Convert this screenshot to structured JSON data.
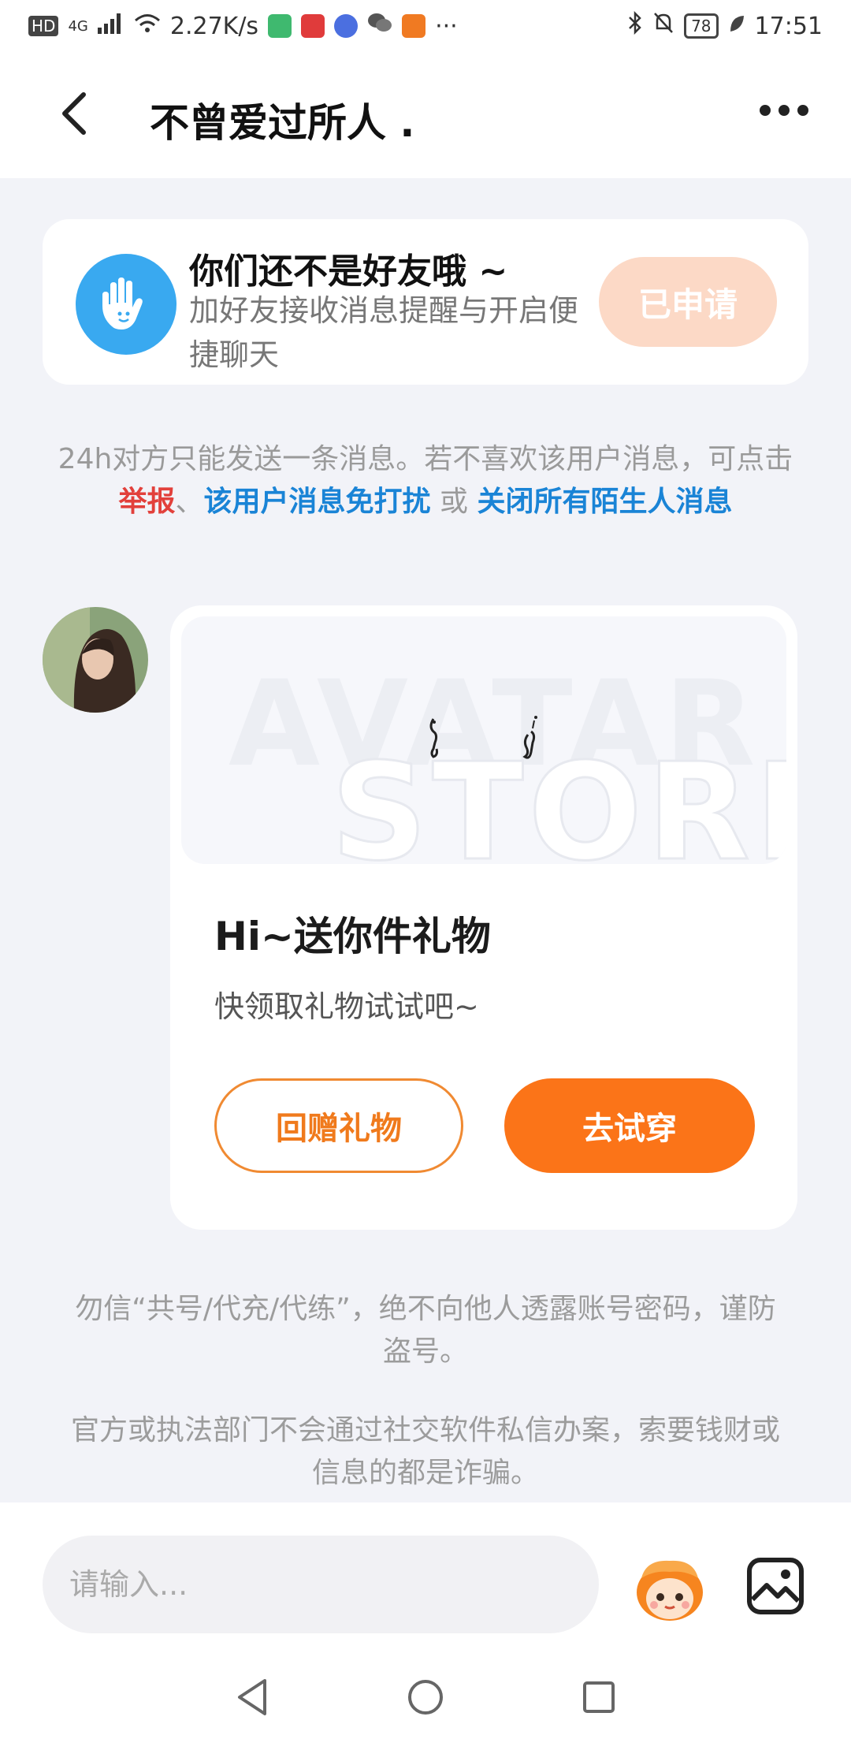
{
  "status_bar": {
    "left_label": "HD",
    "network": "4G",
    "speed": "2.27K/s",
    "battery": "78",
    "time": "17:51"
  },
  "header": {
    "title": "不曾爱过所人 ."
  },
  "friend_card": {
    "title": "你们还不是好友哦 ~",
    "subtitle": "加好友接收消息提醒与开启便捷聊天",
    "button_label": "已申请"
  },
  "notice": {
    "text_start": "24h对方只能发送一条消息。若不喜欢该用户消息，可点击 ",
    "report_link": "举报",
    "sep1": "、",
    "mute_link": "该用户消息免打扰",
    "sep2": " 或 ",
    "close_link": "关闭所有陌生人消息"
  },
  "gift_card": {
    "watermark_line1": "AVATAR",
    "watermark_line2": "STORE",
    "title": "Hi~送你件礼物",
    "subtitle": "快领取礼物试试吧~",
    "return_button": "回赠礼物",
    "try_button": "去试穿"
  },
  "warnings": {
    "w1": "勿信“共号/代充/代练”，绝不向他人透露账号密码，谨防盗号。",
    "w2": "官方或执法部门不会通过社交软件私信办案，索要钱财或信息的都是诈骗。"
  },
  "input": {
    "placeholder": "请输入..."
  },
  "colors": {
    "accent_orange": "#fb7418",
    "applied_pink": "#fcd9c6",
    "link_blue": "#1a84d6",
    "report_red": "#e2403b",
    "hand_blue": "#39a9f0"
  }
}
